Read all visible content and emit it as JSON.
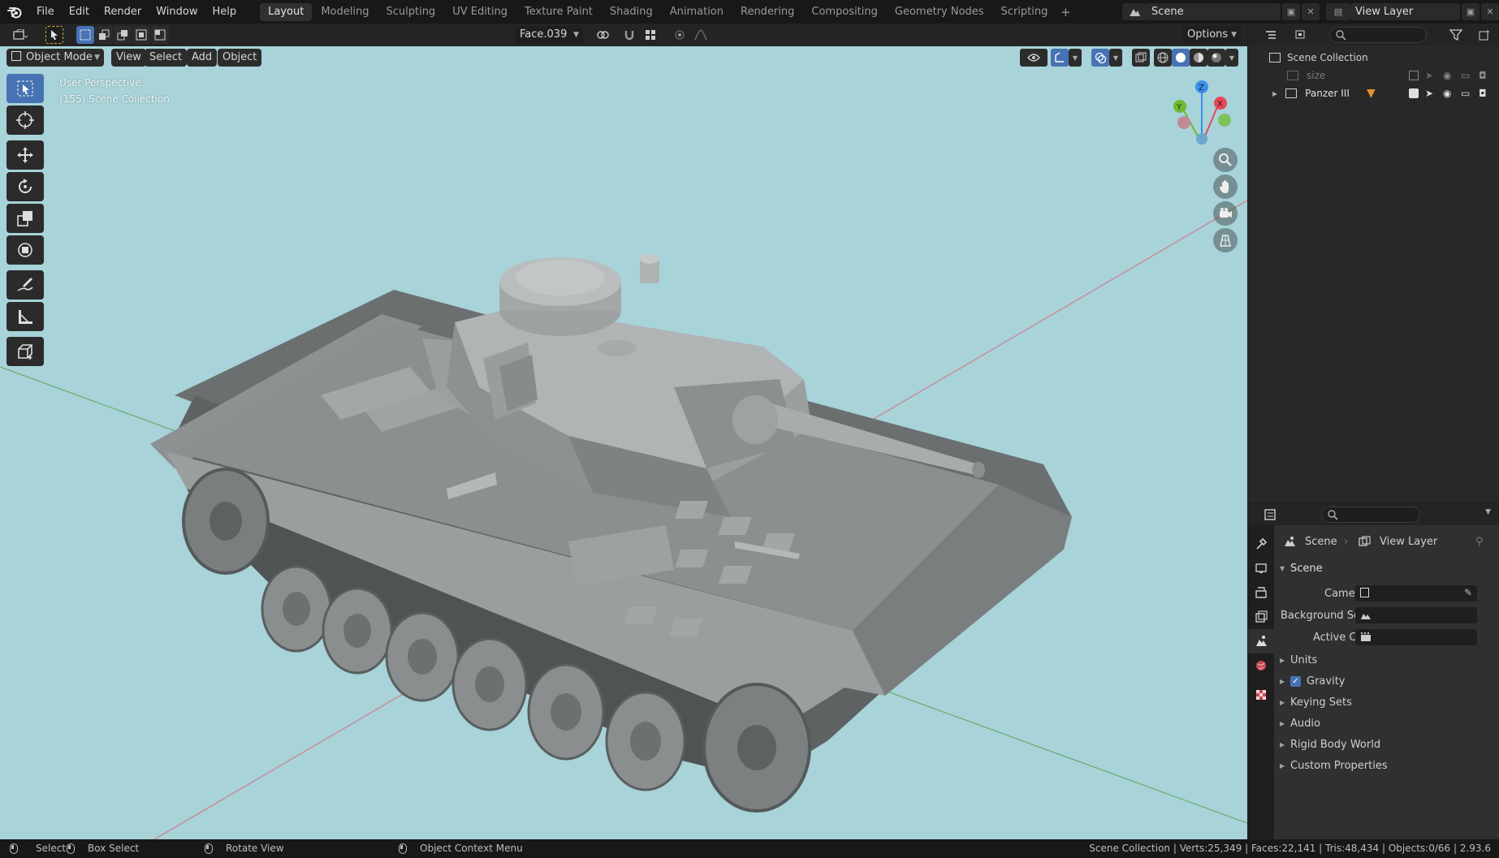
{
  "app": {
    "name": "Blender"
  },
  "menu": [
    "File",
    "Edit",
    "Render",
    "Window",
    "Help"
  ],
  "workspaces": [
    "Layout",
    "Modeling",
    "Sculpting",
    "UV Editing",
    "Texture Paint",
    "Shading",
    "Animation",
    "Rendering",
    "Compositing",
    "Geometry Nodes",
    "Scripting"
  ],
  "active_workspace": "Layout",
  "scene_field": "Scene",
  "view_layer_field": "View Layer",
  "toolbar": {
    "mesh_select": "Face.039",
    "options_label": "Options"
  },
  "viewport_header": {
    "mode": "Object Mode",
    "view": "View",
    "select": "Select",
    "add": "Add",
    "object": "Object"
  },
  "viewport": {
    "perspective": "User Perspective",
    "collection": "(155) Scene Collection",
    "axis_x": "X",
    "axis_y": "Y",
    "axis_z": "Z",
    "background_color": "#a7d3d9",
    "model_color": "#7f8384"
  },
  "outliner": {
    "root": "Scene Collection",
    "items": [
      {
        "label": "size"
      },
      {
        "label": "Panzer III"
      }
    ]
  },
  "properties": {
    "breadcrumb_scene": "Scene",
    "breadcrumb_view_layer": "View Layer",
    "panel_title": "Scene",
    "fields": [
      {
        "label": "Camera"
      },
      {
        "label": "Background Sce..."
      },
      {
        "label": "Active Clip"
      }
    ],
    "subpanels": [
      "Units",
      "Gravity",
      "Keying Sets",
      "Audio",
      "Rigid Body World",
      "Custom Properties"
    ],
    "gravity_checked": true
  },
  "statusbar": {
    "select": "Select",
    "box_select": "Box Select",
    "rotate": "Rotate View",
    "context_menu": "Object Context Menu",
    "stats": "Scene Collection | Verts:25,349 | Faces:22,141 | Tris:48,434 | Objects:0/66 | 2.93.6"
  },
  "colors": {
    "accent": "#4772b3",
    "x_axis": "#e8475a",
    "y_axis": "#6fba2f",
    "z_axis": "#3c8fe6"
  }
}
